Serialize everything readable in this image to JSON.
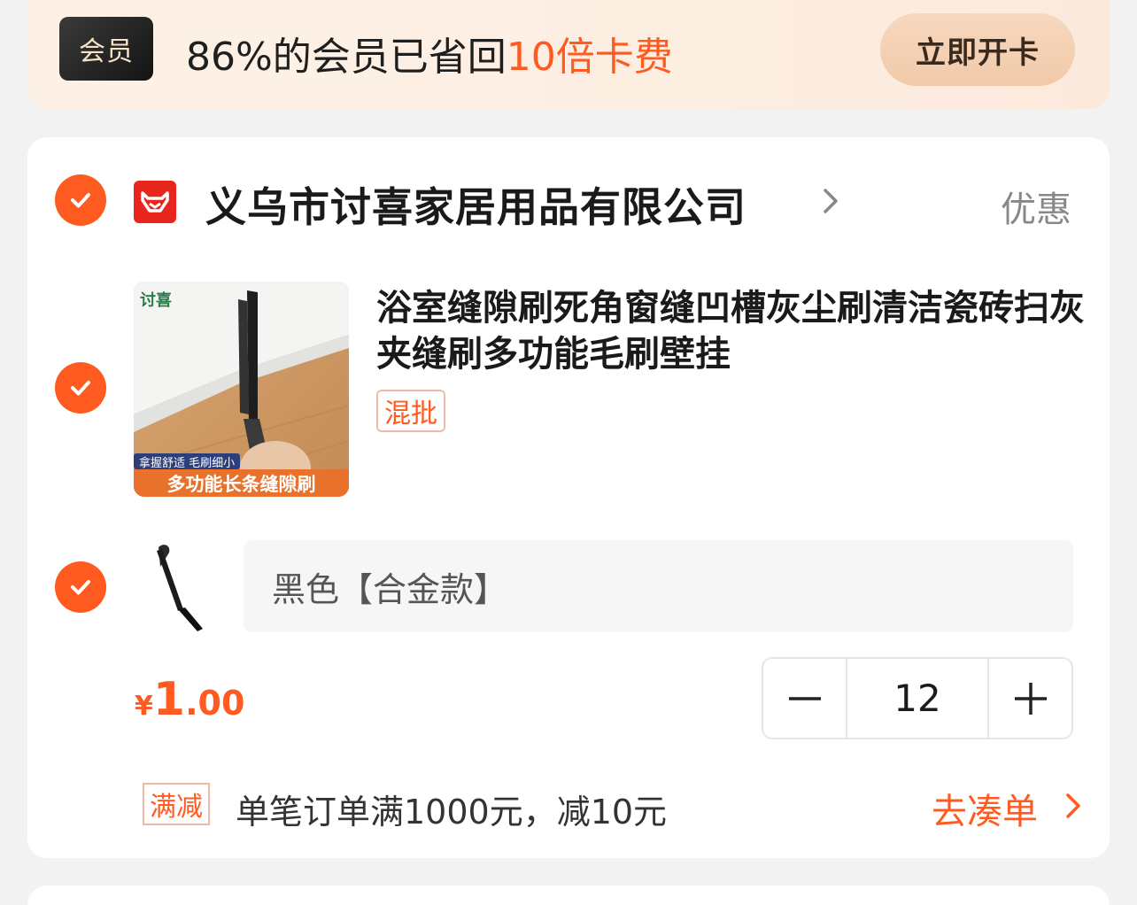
{
  "banner": {
    "badge": "会员",
    "text_prefix": "86%的会员已省回",
    "text_highlight": "10倍卡费",
    "button": "立即开卡"
  },
  "shop": {
    "name": "义乌市讨喜家居用品有限公司",
    "discount_link": "优惠",
    "logo_icon": "tmall-cat-icon"
  },
  "product": {
    "title": "浴室缝隙刷死角窗缝凹槽灰尘刷清洁瓷砖扫灰夹缝刷多功能毛刷壁挂",
    "tag": "混批",
    "image": {
      "brand": "讨喜",
      "caption_small": "拿握舒适  毛刷细小",
      "caption_main": "多功能长条缝隙刷"
    },
    "sku": "黑色【合金款】",
    "price": {
      "currency": "¥",
      "integer": "1",
      "decimal": ".00"
    },
    "quantity": "12"
  },
  "promo": {
    "tag": "满减",
    "text": "单笔订单满1000元，减10元",
    "link": "去凑单"
  },
  "colors": {
    "accent": "#ff5a1f",
    "banner_bg": "#fdf1e6",
    "tmall_red": "#e8261d"
  }
}
